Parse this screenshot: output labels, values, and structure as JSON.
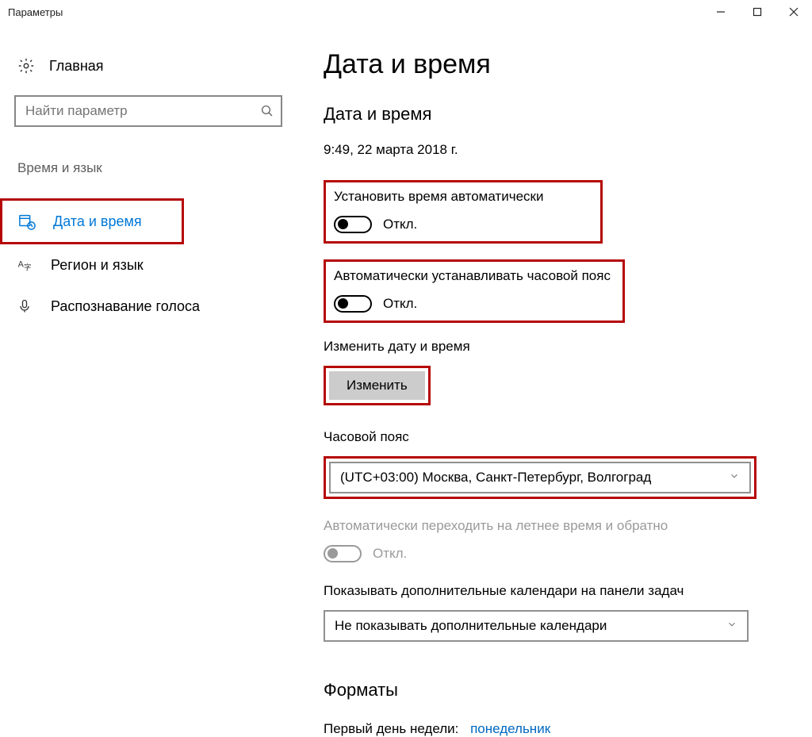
{
  "window": {
    "title": "Параметры"
  },
  "sidebar": {
    "home": "Главная",
    "search_placeholder": "Найти параметр",
    "section": "Время и язык",
    "items": [
      {
        "label": "Дата и время"
      },
      {
        "label": "Регион и язык"
      },
      {
        "label": "Распознавание голоса"
      }
    ]
  },
  "main": {
    "page_title": "Дата и время",
    "section_title": "Дата и время",
    "current_datetime": "9:49, 22 марта 2018 г.",
    "auto_time": {
      "label": "Установить время автоматически",
      "state": "Откл."
    },
    "auto_tz": {
      "label": "Автоматически устанавливать часовой пояс",
      "state": "Откл."
    },
    "change_dt": {
      "label": "Изменить дату и время",
      "button": "Изменить"
    },
    "tz": {
      "label": "Часовой пояс",
      "value": "(UTC+03:00) Москва, Санкт-Петербург, Волгоград"
    },
    "dst": {
      "label": "Автоматически переходить на летнее время и обратно",
      "state": "Откл."
    },
    "extra_cal": {
      "label": "Показывать дополнительные календари на панели задач",
      "value": "Не показывать дополнительные календари"
    },
    "formats": {
      "title": "Форматы",
      "first_day_label": "Первый день недели:",
      "first_day_value": "понедельник"
    }
  }
}
